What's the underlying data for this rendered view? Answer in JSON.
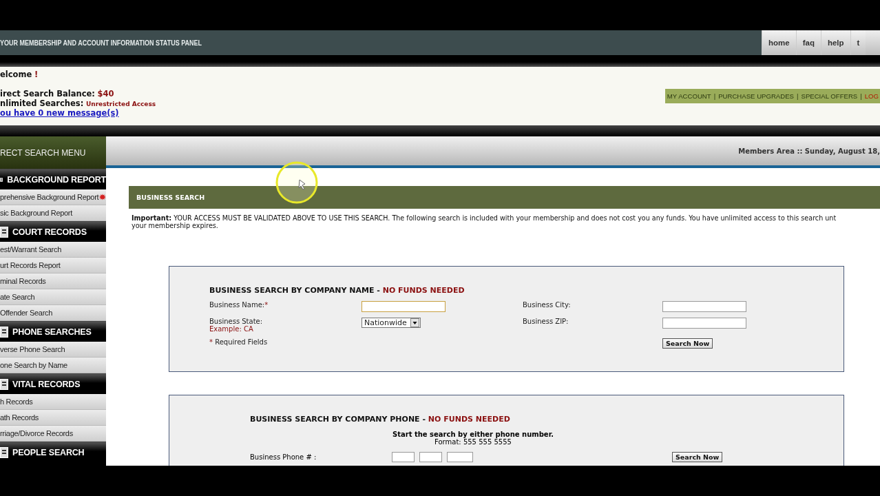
{
  "top_bar": {
    "title": "YOUR MEMBERSHIP AND ACCOUNT INFORMATION STATUS PANEL",
    "nav": [
      {
        "label": "home",
        "selected": false
      },
      {
        "label": "faq",
        "selected": false
      },
      {
        "label": "help",
        "selected": false
      },
      {
        "label": "t",
        "selected": false
      }
    ]
  },
  "status_panel": {
    "welcome": "elcome",
    "welcome_mark": "!",
    "balance_label": "irect Search Balance:",
    "balance_value": "$40",
    "unlimited_label": "nlimited Searches:",
    "unlimited_value": "Unrestricted Access",
    "messages_link": "ou have 0 new message(s)"
  },
  "account_links": {
    "separator": "|",
    "items": [
      {
        "label": "MY ACCOUNT",
        "kind": "link"
      },
      {
        "label": "PURCHASE UPGRADES",
        "kind": "link"
      },
      {
        "label": "SPECIAL OFFERS",
        "kind": "link"
      },
      {
        "label": "LOG",
        "kind": "logout"
      }
    ]
  },
  "sidebar": {
    "title": "RECT SEARCH MENU",
    "items": [
      {
        "kind": "heading",
        "label": "BACKGROUND REPORT"
      },
      {
        "kind": "link",
        "label": "prehensive Background Report",
        "badge": true
      },
      {
        "kind": "link",
        "label": "sic Background Report",
        "badge": false
      },
      {
        "kind": "heading",
        "label": "COURT RECORDS"
      },
      {
        "kind": "link",
        "label": "est/Warrant Search",
        "badge": false
      },
      {
        "kind": "link",
        "label": "urt Records Report",
        "badge": false
      },
      {
        "kind": "link",
        "label": "minal Records",
        "badge": false
      },
      {
        "kind": "link",
        "label": "ate Search",
        "badge": false
      },
      {
        "kind": "link",
        "label": "Offender Search",
        "badge": false
      },
      {
        "kind": "heading",
        "label": "PHONE SEARCHES"
      },
      {
        "kind": "link",
        "label": "verse Phone Search",
        "badge": false
      },
      {
        "kind": "link",
        "label": "one Search by Name",
        "badge": false
      },
      {
        "kind": "heading",
        "label": "VITAL RECORDS"
      },
      {
        "kind": "link",
        "label": "h Records",
        "badge": false
      },
      {
        "kind": "link",
        "label": "ath Records",
        "badge": false
      },
      {
        "kind": "link",
        "label": "rriage/Divorce Records",
        "badge": false
      },
      {
        "kind": "heading",
        "label": "PEOPLE SEARCH"
      }
    ]
  },
  "members_bar": {
    "text": "Members Area :: Sunday, August 18,"
  },
  "section": {
    "title": "BUSINESS SEARCH",
    "notice_lines": [
      "**Important:** YOUR ACCESS MUST BE VALIDATED ABOVE TO USE THIS SEARCH. The following search is included with your membership and does not cost you any funds. You have unlimited access to this search unt",
      "your membership expires."
    ]
  },
  "name_form": {
    "title": "BUSINESS SEARCH BY COMPANY NAME",
    "dash": "-",
    "note": "NO FUNDS NEEDED",
    "name_label": "Business Name:",
    "required_mark": "*",
    "state_label": "Business State:",
    "state_example": "Example: CA",
    "state_value": "Nationwide",
    "city_label": "Business City:",
    "zip_label": "Business ZIP:",
    "required_note": "Required Fields",
    "button": "Search Now"
  },
  "phone_form": {
    "title": "BUSINESS SEARCH BY COMPANY PHONE",
    "dash": "-",
    "note": "NO FUNDS NEEDED",
    "instruction": "Start the search by either phone number.",
    "format": "Format: 555 555 5555",
    "phone_label": "Business Phone # :",
    "button": "Search Now"
  }
}
